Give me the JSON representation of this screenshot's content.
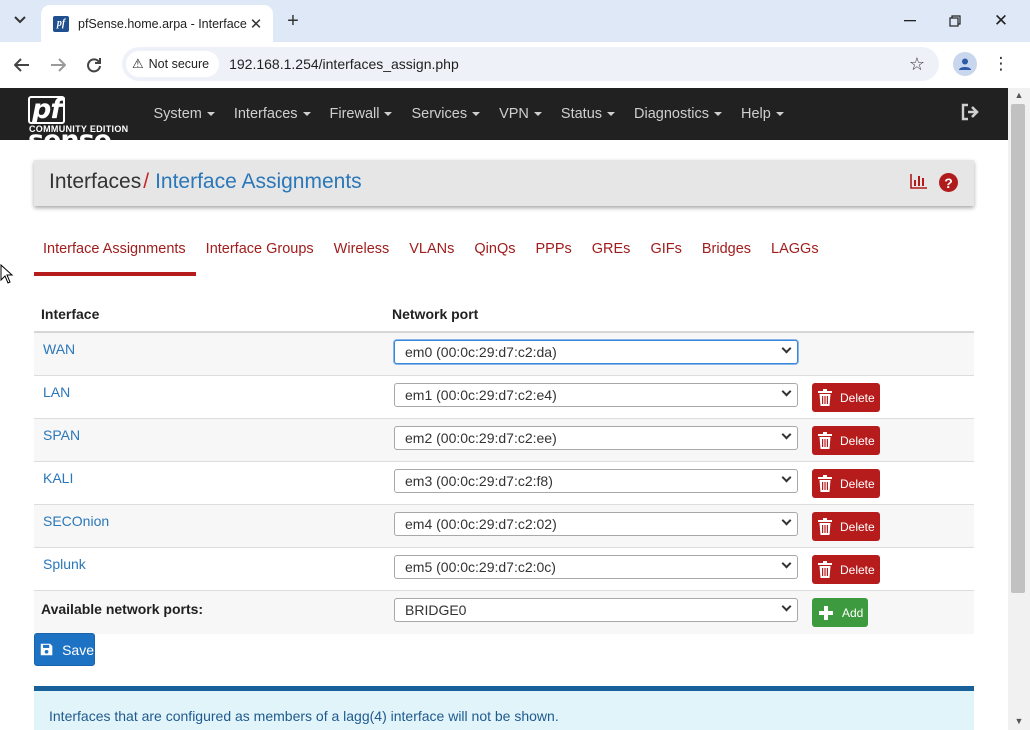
{
  "browser": {
    "tab_title": "pfSense.home.arpa - Interfaces:",
    "favicon_text": "pf",
    "security_label": "Not secure",
    "url": "192.168.1.254/interfaces_assign.php"
  },
  "navbar": {
    "logo_main": "sense",
    "logo_pf": "pf",
    "logo_sub": "COMMUNITY EDITION",
    "menu": [
      {
        "label": "System"
      },
      {
        "label": "Interfaces"
      },
      {
        "label": "Firewall"
      },
      {
        "label": "Services"
      },
      {
        "label": "VPN"
      },
      {
        "label": "Status"
      },
      {
        "label": "Diagnostics"
      },
      {
        "label": "Help"
      }
    ]
  },
  "breadcrumb": {
    "parent": "Interfaces",
    "separator": "/",
    "current": "Interface Assignments"
  },
  "tabs": [
    {
      "label": "Interface Assignments",
      "active": true
    },
    {
      "label": "Interface Groups"
    },
    {
      "label": "Wireless"
    },
    {
      "label": "VLANs"
    },
    {
      "label": "QinQs"
    },
    {
      "label": "PPPs"
    },
    {
      "label": "GREs"
    },
    {
      "label": "GIFs"
    },
    {
      "label": "Bridges"
    },
    {
      "label": "LAGGs"
    }
  ],
  "table": {
    "headers": {
      "interface": "Interface",
      "network_port": "Network port"
    },
    "rows": [
      {
        "interface": "WAN",
        "port": "em0 (00:0c:29:d7:c2:da)"
      },
      {
        "interface": "LAN",
        "port": "em1 (00:0c:29:d7:c2:e4)",
        "action": "Delete"
      },
      {
        "interface": "SPAN",
        "port": "em2 (00:0c:29:d7:c2:ee)",
        "action": "Delete"
      },
      {
        "interface": "KALI",
        "port": "em3 (00:0c:29:d7:c2:f8)",
        "action": "Delete"
      },
      {
        "interface": "SECOnion",
        "port": "em4 (00:0c:29:d7:c2:02)",
        "action": "Delete"
      },
      {
        "interface": "Splunk",
        "port": "em5 (00:0c:29:d7:c2:0c)",
        "action": "Delete"
      }
    ],
    "available": {
      "label": "Available network ports:",
      "selected": "BRIDGE0",
      "action": "Add"
    }
  },
  "save_label": "Save",
  "info_text": "Interfaces that are configured as members of a lagg(4) interface will not be shown.",
  "colors": {
    "navbar_bg": "#212121",
    "link_blue": "#2a77b9",
    "tab_red": "#a11d1d",
    "delete_red": "#b71c1c",
    "add_green": "#3e9a3e",
    "save_blue": "#1e72c4",
    "info_bg": "#e1f4fa"
  }
}
